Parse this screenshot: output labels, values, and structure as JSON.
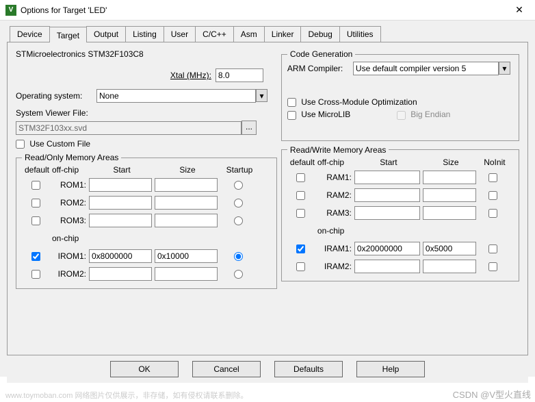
{
  "window": {
    "title": "Options for Target 'LED'"
  },
  "tabs": [
    "Device",
    "Target",
    "Output",
    "Listing",
    "User",
    "C/C++",
    "Asm",
    "Linker",
    "Debug",
    "Utilities"
  ],
  "active_tab": "Target",
  "device_name": "STMicroelectronics STM32F103C8",
  "xtal": {
    "label": "Xtal (MHz):",
    "value": "8.0"
  },
  "os": {
    "label": "Operating system:",
    "value": "None"
  },
  "svf": {
    "label": "System Viewer File:",
    "value": "STM32F103xx.svd"
  },
  "use_custom_file": "Use Custom File",
  "codegen": {
    "legend": "Code Generation",
    "arm_label": "ARM Compiler:",
    "arm_value": "Use default compiler version 5",
    "cross": "Use Cross-Module Optimization",
    "microlib": "Use MicroLIB",
    "bigendian": "Big Endian"
  },
  "ro": {
    "legend": "Read/Only Memory Areas",
    "hdr": {
      "def": "default",
      "off": "off-chip",
      "start": "Start",
      "size": "Size",
      "startup": "Startup"
    },
    "rows": [
      {
        "name": "ROM1:",
        "start": "",
        "size": "",
        "def": false,
        "sel": false
      },
      {
        "name": "ROM2:",
        "start": "",
        "size": "",
        "def": false,
        "sel": false
      },
      {
        "name": "ROM3:",
        "start": "",
        "size": "",
        "def": false,
        "sel": false
      }
    ],
    "onchip": "on-chip",
    "irows": [
      {
        "name": "IROM1:",
        "start": "0x8000000",
        "size": "0x10000",
        "def": true,
        "sel": true
      },
      {
        "name": "IROM2:",
        "start": "",
        "size": "",
        "def": false,
        "sel": false
      }
    ]
  },
  "rw": {
    "legend": "Read/Write Memory Areas",
    "hdr": {
      "def": "default",
      "off": "off-chip",
      "start": "Start",
      "size": "Size",
      "noinit": "NoInit"
    },
    "rows": [
      {
        "name": "RAM1:",
        "start": "",
        "size": "",
        "def": false,
        "ni": false
      },
      {
        "name": "RAM2:",
        "start": "",
        "size": "",
        "def": false,
        "ni": false
      },
      {
        "name": "RAM3:",
        "start": "",
        "size": "",
        "def": false,
        "ni": false
      }
    ],
    "onchip": "on-chip",
    "irows": [
      {
        "name": "IRAM1:",
        "start": "0x20000000",
        "size": "0x5000",
        "def": true,
        "ni": false
      },
      {
        "name": "IRAM2:",
        "start": "",
        "size": "",
        "def": false,
        "ni": false
      }
    ]
  },
  "buttons": {
    "ok": "OK",
    "cancel": "Cancel",
    "defaults": "Defaults",
    "help": "Help"
  },
  "watermarks": {
    "left": "www.toymoban.com  网络图片仅供展示，非存储，如有侵权请联系删除。",
    "right": "CSDN @V型火直线"
  }
}
